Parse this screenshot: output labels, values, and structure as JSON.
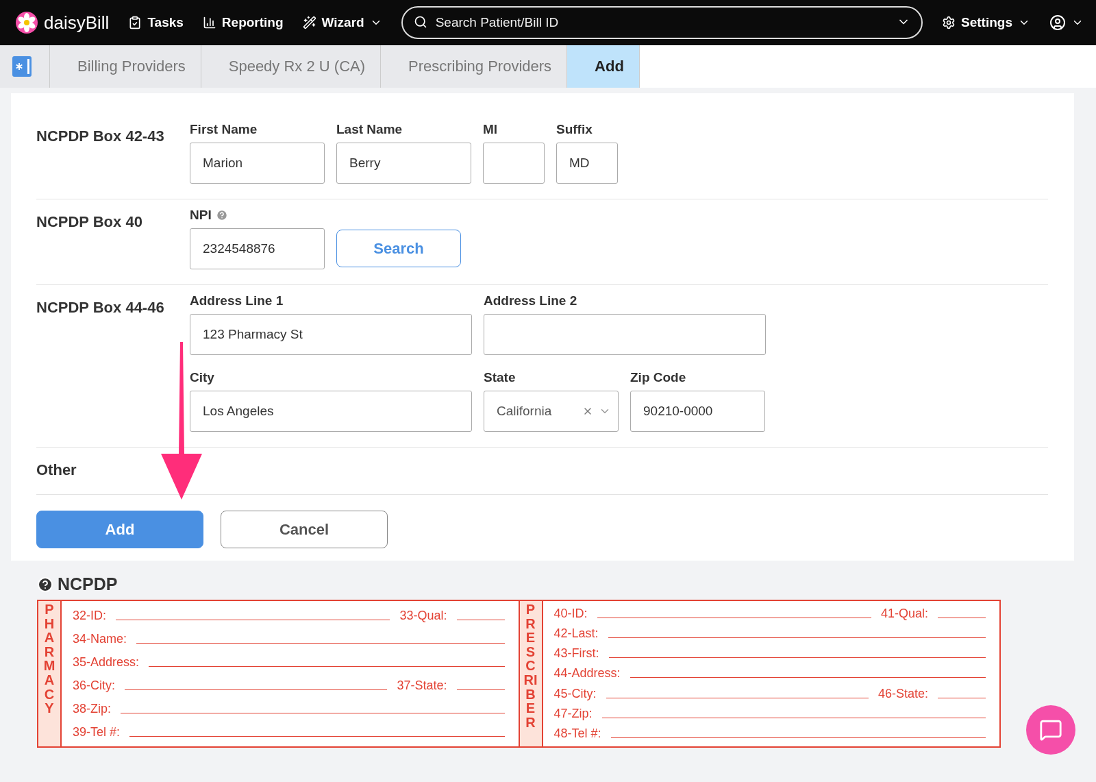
{
  "nav": {
    "brand": "daisyBill",
    "items": [
      {
        "label": "Tasks"
      },
      {
        "label": "Reporting"
      },
      {
        "label": "Wizard"
      }
    ],
    "search": {
      "placeholder": "Search Patient/Bill ID"
    },
    "settings": "Settings"
  },
  "breadcrumb": [
    {
      "label": "Billing Providers",
      "selected": false
    },
    {
      "label": "Speedy Rx 2 U (CA)",
      "selected": false
    },
    {
      "label": "Prescribing Providers",
      "selected": false
    },
    {
      "label": "Add",
      "selected": true
    }
  ],
  "sections": [
    {
      "title": "NCPDP Box 42-43",
      "rows": [
        [
          {
            "kind": "input",
            "label": "First Name",
            "value": "Marion"
          },
          {
            "kind": "input",
            "label": "Last Name",
            "value": "Berry"
          },
          {
            "kind": "input",
            "label": "MI"
          },
          {
            "kind": "input",
            "label": "Suffix",
            "value": "MD"
          }
        ]
      ]
    },
    {
      "title": "NCPDP Box 40",
      "rows": [
        [
          {
            "kind": "input",
            "label": "NPI",
            "value": "2324548876"
          },
          {
            "kind": "button",
            "label": "Search"
          }
        ]
      ]
    },
    {
      "title": "NCPDP Box 44-46",
      "rows": [
        [
          {
            "kind": "input",
            "label": "Address Line 1",
            "value": "123 Pharmacy St"
          },
          {
            "kind": "input",
            "label": "Address Line 2"
          }
        ],
        [
          {
            "kind": "input",
            "label": "City",
            "value": "Los Angeles"
          },
          {
            "kind": "select",
            "label": "State",
            "value": "California"
          },
          {
            "kind": "input",
            "label": "Zip Code",
            "value": "90210-0000"
          }
        ]
      ]
    },
    {
      "title": "Other"
    }
  ],
  "actions": {
    "primary": "Add",
    "secondary": "Cancel"
  },
  "ncpdp": {
    "title": "NCPDP",
    "panels": [
      {
        "side": "PHARMACY",
        "rows": [
          [
            "32-ID:",
            "33-Qual:"
          ],
          [
            "34-Name:"
          ],
          [
            "35-Address:"
          ],
          [
            "36-City:",
            "37-State:"
          ],
          [
            "38-Zip:"
          ],
          [
            "39-Tel #:"
          ]
        ]
      },
      {
        "side": "PRESCRIBER",
        "rows": [
          [
            "40-ID:",
            "41-Qual:"
          ],
          [
            "42-Last:"
          ],
          [
            "43-First:"
          ],
          [
            "44-Address:"
          ],
          [
            "45-City:",
            "46-State:"
          ],
          [
            "47-Zip:"
          ],
          [
            "48-Tel #:"
          ]
        ]
      }
    ]
  }
}
